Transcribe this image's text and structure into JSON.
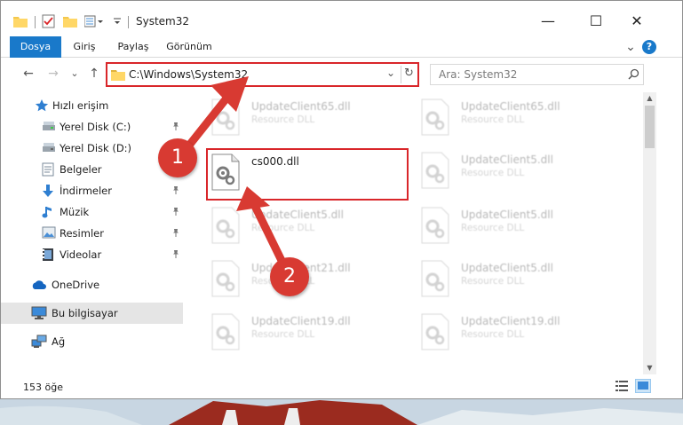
{
  "window": {
    "title": "System32",
    "minimize_glyph": "—",
    "maximize_glyph": "☐",
    "close_glyph": "✕"
  },
  "ribbon": {
    "tabs": [
      {
        "label": "Dosya"
      },
      {
        "label": "Giriş"
      },
      {
        "label": "Paylaş"
      },
      {
        "label": "Görünüm"
      }
    ],
    "expand_glyph": "⌄",
    "help_glyph": "?"
  },
  "address": {
    "path": "C:\\Windows\\System32",
    "back_glyph": "←",
    "forward_glyph": "→",
    "recent_glyph": "⌄",
    "up_glyph": "↑",
    "dropdown_glyph": "⌄",
    "refresh_glyph": "↻"
  },
  "search": {
    "placeholder": "Ara: System32",
    "icon": "search-icon"
  },
  "sidebar": {
    "items": [
      {
        "label": "Hızlı erişim",
        "icon": "star-icon",
        "pinned": false
      },
      {
        "label": "Yerel Disk (C:)",
        "icon": "drive-icon",
        "pinned": true
      },
      {
        "label": "Yerel Disk (D:)",
        "icon": "drive-icon",
        "pinned": false
      },
      {
        "label": "Belgeler",
        "icon": "documents-icon",
        "pinned": false
      },
      {
        "label": "İndirmeler",
        "icon": "download-icon",
        "pinned": true
      },
      {
        "label": "Müzik",
        "icon": "music-icon",
        "pinned": true
      },
      {
        "label": "Resimler",
        "icon": "pictures-icon",
        "pinned": true
      },
      {
        "label": "Videolar",
        "icon": "video-icon",
        "pinned": true
      },
      {
        "label": "OneDrive",
        "icon": "cloud-icon",
        "pinned": false
      },
      {
        "label": "Bu bilgisayar",
        "icon": "computer-icon",
        "pinned": false,
        "selected": true
      },
      {
        "label": "Ağ",
        "icon": "network-icon",
        "pinned": false
      }
    ],
    "pin_glyph": "📌"
  },
  "files": {
    "left_column": [
      {
        "name": "UpdateClient65.dll",
        "type": "Resource DLL",
        "faded": true
      },
      {
        "name": "cs000.dll",
        "type": "",
        "faded": false
      },
      {
        "name": "UpdateClient5.dll",
        "type": "Resource DLL",
        "faded": true
      },
      {
        "name": "UpdateClient21.dll",
        "type": "Resource DLL",
        "faded": true
      },
      {
        "name": "UpdateClient19.dll",
        "type": "Resource DLL",
        "faded": true
      }
    ],
    "right_column": [
      {
        "name": "UpdateClient65.dll",
        "type": "Resource DLL",
        "faded": true
      },
      {
        "name": "UpdateClient5.dll",
        "type": "Resource DLL",
        "faded": true
      },
      {
        "name": "UpdateClient5.dll",
        "type": "Resource DLL",
        "faded": true
      },
      {
        "name": "UpdateClient5.dll",
        "type": "Resource DLL",
        "faded": true
      },
      {
        "name": "UpdateClient19.dll",
        "type": "Resource DLL",
        "faded": true
      }
    ]
  },
  "status": {
    "item_count": "153 öğe"
  },
  "annotations": {
    "step1": "1",
    "step2": "2",
    "color": "#d9262a"
  },
  "colors": {
    "accent": "#1979ca",
    "highlight": "#d9262a"
  }
}
